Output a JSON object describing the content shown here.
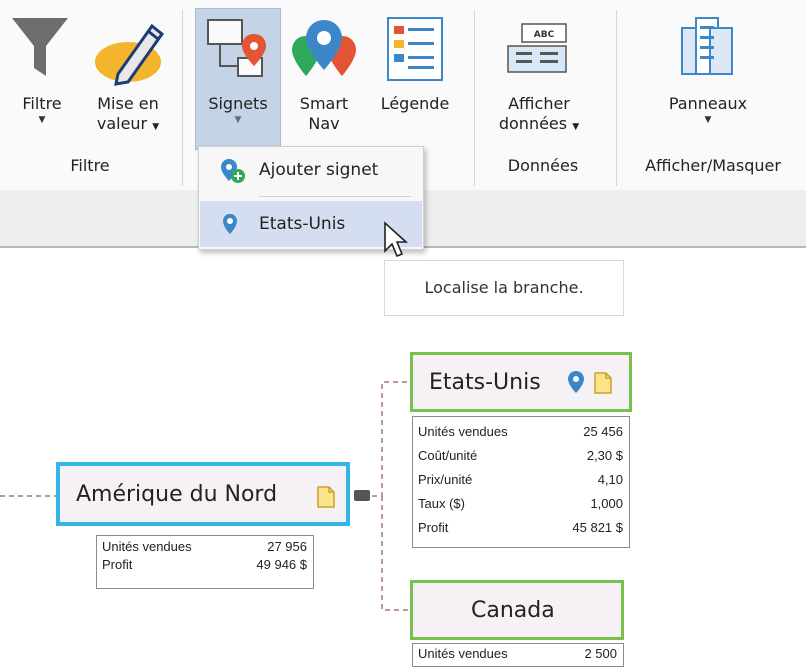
{
  "ribbon": {
    "groups": {
      "filtre": {
        "label": "Filtre",
        "buttons": {
          "filtre": {
            "label": "Filtre"
          },
          "mise_en_valeur": {
            "line1": "Mise en",
            "line2": "valeur"
          }
        }
      },
      "signets": {
        "buttons": {
          "signets": {
            "label": "Signets"
          },
          "smart_nav": {
            "line1": "Smart",
            "line2": "Nav"
          },
          "legende": {
            "label": "Légende"
          }
        }
      },
      "donnees": {
        "label": "Données",
        "buttons": {
          "afficher_donnees": {
            "line1": "Afficher",
            "line2": "données"
          }
        }
      },
      "afficher_masquer": {
        "label": "Afficher/Masquer",
        "buttons": {
          "panneaux": {
            "label": "Panneaux"
          }
        }
      }
    }
  },
  "menu": {
    "items": [
      {
        "label": "Ajouter signet",
        "icon": "add-bookmark-icon"
      },
      {
        "label": "Etats-Unis",
        "icon": "location-pin-icon"
      }
    ]
  },
  "tooltip": {
    "text": "Localise la branche."
  },
  "nodes": {
    "amerique": {
      "title": "Amérique du Nord",
      "rows": [
        {
          "k": "Unités vendues",
          "v": "27 956"
        },
        {
          "k": "Profit",
          "v": "49 946 $"
        }
      ]
    },
    "etats_unis": {
      "title": "Etats-Unis",
      "rows": [
        {
          "k": "Unités vendues",
          "v": "25 456"
        },
        {
          "k": "Coût/unité",
          "v": "2,30 $"
        },
        {
          "k": "Prix/unité",
          "v": "4,10"
        },
        {
          "k": "Taux ($)",
          "v": "1,000"
        },
        {
          "k": "Profit",
          "v": "45 821 $"
        }
      ]
    },
    "canada": {
      "title": "Canada",
      "rows": [
        {
          "k": "Unités vendues",
          "v": "2 500"
        }
      ]
    }
  },
  "colors": {
    "selected_node_border": "#33b5e8",
    "child_node_border": "#79c04f",
    "connector": "#a07878",
    "active_button": "#c5d3e6",
    "pin_blue": "#3b87c8"
  }
}
